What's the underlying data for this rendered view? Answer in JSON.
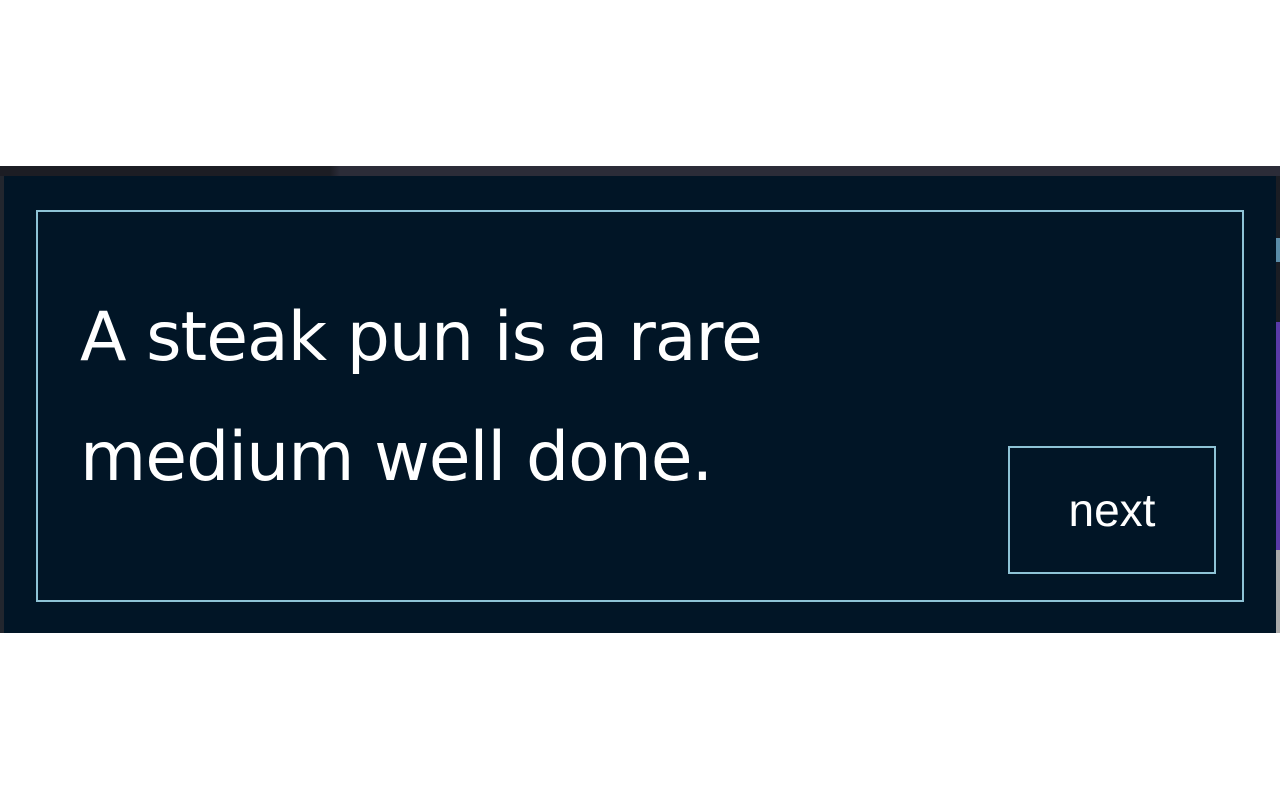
{
  "joke": {
    "text": "A steak pun is a rare medium well done."
  },
  "controls": {
    "next_label": "next"
  },
  "colors": {
    "background": "#011526",
    "border": "#8ec3d6",
    "text": "#ffffff"
  }
}
